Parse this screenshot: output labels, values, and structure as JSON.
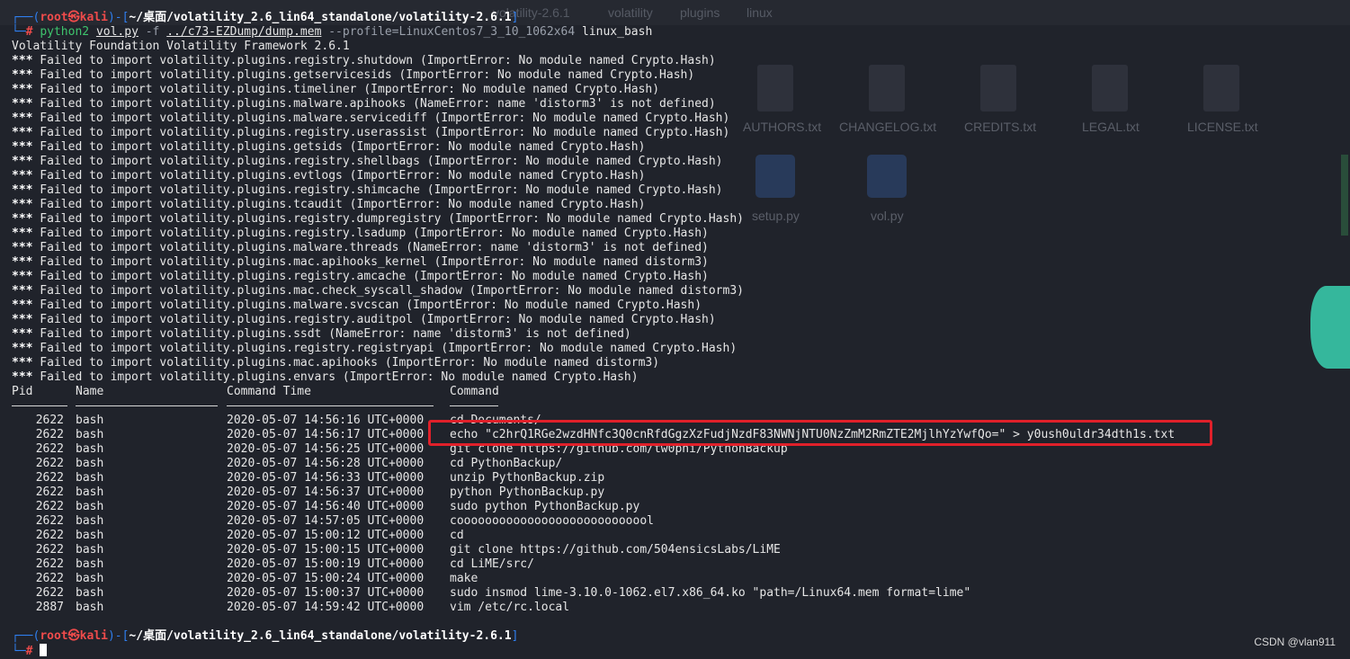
{
  "background": {
    "tabs": [
      "volatility-2.6.1",
      "volatility",
      "plugins",
      "linux"
    ],
    "files": [
      "AUTHORS.txt",
      "CHANGELOG.txt",
      "CREDITS.txt",
      "LEGAL.txt",
      "LICENSE.txt",
      "setup.py",
      "vol.py"
    ]
  },
  "prompt1": {
    "corner1": "┌──(",
    "user": "root㉿kali",
    "mid": ")-[",
    "path": "~/桌面/volatility_2.6_lin64_standalone/volatility-2.6.1",
    "close": "]",
    "corner2": "└─",
    "hash": "#",
    "cmd_python": "python2",
    "cmd_script": "vol.py",
    "cmd_flag_f": "-f",
    "cmd_file": "../c73-EZDump/dump.mem",
    "cmd_profile": "--profile=LinuxCentos7_3_10_1062x64",
    "cmd_plugin": "linux_bash"
  },
  "banner": "Volatility Foundation Volatility Framework 2.6.1",
  "warn_prefix": "***",
  "warnings": [
    " Failed to import volatility.plugins.registry.shutdown (ImportError: No module named Crypto.Hash)",
    " Failed to import volatility.plugins.getservicesids (ImportError: No module named Crypto.Hash)",
    " Failed to import volatility.plugins.timeliner (ImportError: No module named Crypto.Hash)",
    " Failed to import volatility.plugins.malware.apihooks (NameError: name 'distorm3' is not defined)",
    " Failed to import volatility.plugins.malware.servicediff (ImportError: No module named Crypto.Hash)",
    " Failed to import volatility.plugins.registry.userassist (ImportError: No module named Crypto.Hash)",
    " Failed to import volatility.plugins.getsids (ImportError: No module named Crypto.Hash)",
    " Failed to import volatility.plugins.registry.shellbags (ImportError: No module named Crypto.Hash)",
    " Failed to import volatility.plugins.evtlogs (ImportError: No module named Crypto.Hash)",
    " Failed to import volatility.plugins.registry.shimcache (ImportError: No module named Crypto.Hash)",
    " Failed to import volatility.plugins.tcaudit (ImportError: No module named Crypto.Hash)",
    " Failed to import volatility.plugins.registry.dumpregistry (ImportError: No module named Crypto.Hash)",
    " Failed to import volatility.plugins.registry.lsadump (ImportError: No module named Crypto.Hash)",
    " Failed to import volatility.plugins.malware.threads (NameError: name 'distorm3' is not defined)",
    " Failed to import volatility.plugins.mac.apihooks_kernel (ImportError: No module named distorm3)",
    " Failed to import volatility.plugins.registry.amcache (ImportError: No module named Crypto.Hash)",
    " Failed to import volatility.plugins.mac.check_syscall_shadow (ImportError: No module named distorm3)",
    " Failed to import volatility.plugins.malware.svcscan (ImportError: No module named Crypto.Hash)",
    " Failed to import volatility.plugins.registry.auditpol (ImportError: No module named Crypto.Hash)",
    " Failed to import volatility.plugins.ssdt (NameError: name 'distorm3' is not defined)",
    " Failed to import volatility.plugins.registry.registryapi (ImportError: No module named Crypto.Hash)",
    " Failed to import volatility.plugins.mac.apihooks (ImportError: No module named distorm3)",
    " Failed to import volatility.plugins.envars (ImportError: No module named Crypto.Hash)"
  ],
  "table": {
    "headers": [
      "Pid",
      "Name",
      "Command Time",
      "Command"
    ],
    "rows": [
      {
        "pid": "2622",
        "name": "bash",
        "time": "2020-05-07 14:56:16 UTC+0000",
        "cmd": "cd Documents/"
      },
      {
        "pid": "2622",
        "name": "bash",
        "time": "2020-05-07 14:56:17 UTC+0000",
        "cmd": "echo \"c2hrQ1RGe2wzdHNfc3Q0cnRfdGgzXzFudjNzdF83NWNjNTU0NzZmM2RmZTE2MjlhYzYwfQo=\" > y0ush0uldr34dth1s.txt"
      },
      {
        "pid": "2622",
        "name": "bash",
        "time": "2020-05-07 14:56:25 UTC+0000",
        "cmd": "git clone https://github.com/tw0phi/PythonBackup"
      },
      {
        "pid": "2622",
        "name": "bash",
        "time": "2020-05-07 14:56:28 UTC+0000",
        "cmd": "cd PythonBackup/"
      },
      {
        "pid": "2622",
        "name": "bash",
        "time": "2020-05-07 14:56:33 UTC+0000",
        "cmd": "unzip PythonBackup.zip"
      },
      {
        "pid": "2622",
        "name": "bash",
        "time": "2020-05-07 14:56:37 UTC+0000",
        "cmd": "python PythonBackup.py"
      },
      {
        "pid": "2622",
        "name": "bash",
        "time": "2020-05-07 14:56:40 UTC+0000",
        "cmd": "sudo python PythonBackup.py"
      },
      {
        "pid": "2622",
        "name": "bash",
        "time": "2020-05-07 14:57:05 UTC+0000",
        "cmd": "coooooooooooooooooooooooooool"
      },
      {
        "pid": "2622",
        "name": "bash",
        "time": "2020-05-07 15:00:12 UTC+0000",
        "cmd": "cd"
      },
      {
        "pid": "2622",
        "name": "bash",
        "time": "2020-05-07 15:00:15 UTC+0000",
        "cmd": "git clone https://github.com/504ensicsLabs/LiME"
      },
      {
        "pid": "2622",
        "name": "bash",
        "time": "2020-05-07 15:00:19 UTC+0000",
        "cmd": "cd LiME/src/"
      },
      {
        "pid": "2622",
        "name": "bash",
        "time": "2020-05-07 15:00:24 UTC+0000",
        "cmd": "make"
      },
      {
        "pid": "2622",
        "name": "bash",
        "time": "2020-05-07 15:00:37 UTC+0000",
        "cmd": "sudo insmod lime-3.10.0-1062.el7.x86_64.ko \"path=/Linux64.mem format=lime\""
      },
      {
        "pid": "2887",
        "name": "bash",
        "time": "2020-05-07 14:59:42 UTC+0000",
        "cmd": "vim /etc/rc.local"
      }
    ]
  },
  "prompt2": {
    "corner1": "┌──(",
    "user": "root㉿kali",
    "mid": ")-[",
    "path": "~/桌面/volatility_2.6_lin64_standalone/volatility-2.6.1",
    "close": "]",
    "corner2": "└─",
    "hash": "#"
  },
  "watermark": "CSDN @vlan911",
  "colors": {
    "prompt_blue": "#2f7ff0",
    "prompt_red": "#ef4b4b",
    "command_green": "#3ec46d",
    "highlight_box": "#e0202a"
  }
}
